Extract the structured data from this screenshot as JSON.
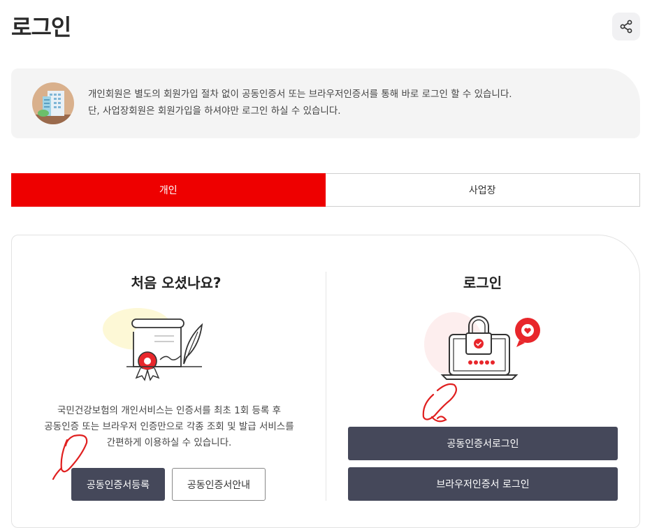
{
  "header": {
    "title": "로그인",
    "share_icon": "share-icon"
  },
  "notice": {
    "icon": "building-icon",
    "line1": "개인회원은 별도의 회원가입 절차 없이 공동인증서 또는 브라우저인증서를 통해 바로 로그인 할 수 있습니다.",
    "line2": "단, 사업장회원은 회원가입을 하셔야만 로그인 하실 수 있습니다."
  },
  "tabs": [
    {
      "label": "개인",
      "active": true
    },
    {
      "label": "사업장",
      "active": false
    }
  ],
  "left": {
    "title": "처음 오셨나요?",
    "illustration": "certificate-icon",
    "desc_lines": [
      "국민건강보험의 개인서비스는 인증서를 최초 1회 등록 후",
      "공동인증 또는 브라우저 인증만으로 각종 조회 및 발급 서비스를",
      "간편하게 이용하실 수 있습니다."
    ],
    "register_button": "공동인증서등록",
    "guide_button": "공동인증서안내"
  },
  "right": {
    "title": "로그인",
    "illustration": "laptop-lock-icon",
    "cert_login_button": "공동인증서로그인",
    "browser_login_button": "브라우저인증서 로그인"
  },
  "colors": {
    "accent": "#ee0000",
    "dark_button": "#45485a",
    "annotation": "#e02020"
  }
}
